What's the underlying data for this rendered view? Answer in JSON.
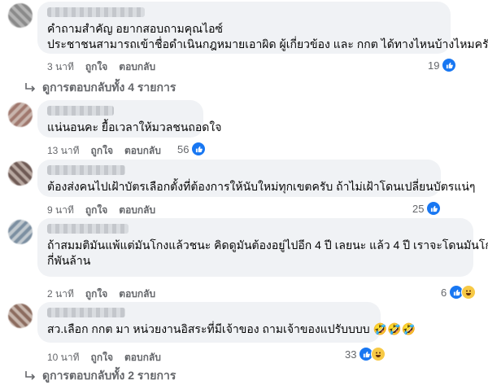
{
  "comments": [
    {
      "lines": [
        "คำถามสำคัญ อยากสอบถามคุณไอซ์",
        "ประชาชนสามารถเข้าชื่อดำเนินกฎหมายเอาผิด ผู้เกี่ยวข้อง และ กกต ได้ทางไหนบ้างไหมครับ"
      ],
      "time": "3 นาที",
      "like_label": "ถูกใจ",
      "reply_label": "ตอบกลับ",
      "reaction_count": "19",
      "reactions": [
        "like-icon"
      ]
    },
    {
      "lines": [
        "แน่นอนคะ ยื้อเวลาให้มวลชนถอดใจ"
      ],
      "time": "13 นาที",
      "like_label": "ถูกใจ",
      "reply_label": "ตอบกลับ",
      "reaction_count": "56",
      "reactions": [
        "like-icon"
      ]
    },
    {
      "lines": [
        "ต้องส่งคนไปเฝ้าบัตรเลือกตั้งที่ต้องการให้นับใหม่ทุกเขตครับ ถ้าไม่เฝ้าโดนเปลี่ยนบัตรแน่ๆ"
      ],
      "time": "9 นาที",
      "like_label": "ถูกใจ",
      "reply_label": "ตอบกลับ",
      "reaction_count": "25",
      "reactions": [
        "like-icon"
      ]
    },
    {
      "lines": [
        "ถ้าสมมติมันแพ้แต่มันโกงแล้วชนะ คิดดูมันต้องอยู่ไปอีก 4 ปี เลยนะ แล้ว 4 ปี เราจะโดนมันโกงอีก",
        "กี่พันล้าน"
      ],
      "time": "2 นาที",
      "like_label": "ถูกใจ",
      "reply_label": "ตอบกลับ",
      "reaction_count": "6",
      "reactions": [
        "like-icon",
        "haha-icon"
      ]
    },
    {
      "lines": [
        "สว.เลือก กกต มา หน่วยงานอิสระที่มีเจ้าของ ถามเจ้าของแปรับบบบ 🤣🤣🤣"
      ],
      "time": "10 นาที",
      "like_label": "ถูกใจ",
      "reply_label": "ตอบกลับ",
      "reaction_count": "33",
      "reactions": [
        "like-icon",
        "haha-icon"
      ]
    }
  ],
  "view_replies": [
    "ดูการตอบกลับทั้ง 4 รายการ",
    "ดูการตอบกลับทั้ง 2 รายการ"
  ],
  "colors": {
    "bubble": "#f0f2f5",
    "meta": "#65676b",
    "like": "#1877f2",
    "haha": "#f7c945"
  }
}
